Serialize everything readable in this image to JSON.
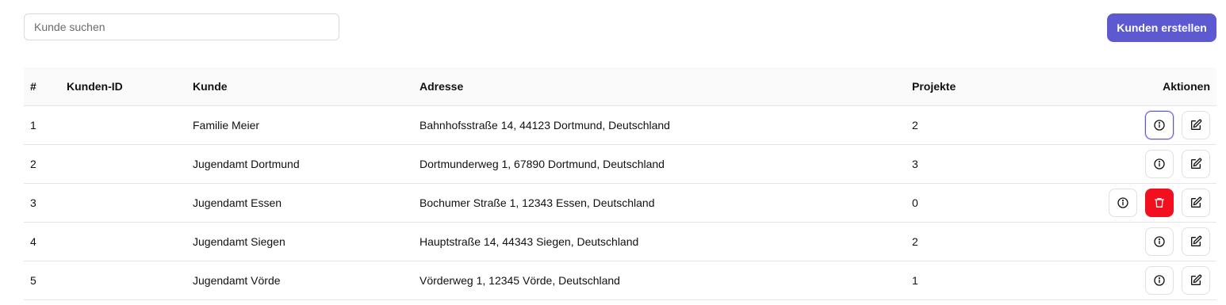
{
  "search": {
    "placeholder": "Kunde suchen",
    "value": ""
  },
  "create_button": {
    "label": "Kunden erstellen",
    "color": "#5d5ad1"
  },
  "table": {
    "headers": {
      "num": "#",
      "id": "Kunden-ID",
      "kunde": "Kunde",
      "adresse": "Adresse",
      "projekte": "Projekte",
      "aktionen": "Aktionen"
    },
    "rows": [
      {
        "num": "1",
        "id": "",
        "kunde": "Familie Meier",
        "adresse": "Bahnhofsstraße 14, 44123 Dortmund, Deutschland",
        "projekte": "2",
        "actions": [
          "info-icon",
          "edit-icon"
        ]
      },
      {
        "num": "2",
        "id": "",
        "kunde": "Jugendamt Dortmund",
        "adresse": "Dortmunderweg 1, 67890 Dortmund, Deutschland",
        "projekte": "3",
        "actions": [
          "info-icon",
          "edit-icon"
        ]
      },
      {
        "num": "3",
        "id": "",
        "kunde": "Jugendamt Essen",
        "adresse": "Bochumer Straße 1, 12343 Essen, Deutschland",
        "projekte": "0",
        "actions": [
          "info-icon",
          "trash-icon",
          "edit-icon"
        ]
      },
      {
        "num": "4",
        "id": "",
        "kunde": "Jugendamt Siegen",
        "adresse": "Hauptstraße 14, 44343 Siegen, Deutschland",
        "projekte": "2",
        "actions": [
          "info-icon",
          "edit-icon"
        ]
      },
      {
        "num": "5",
        "id": "",
        "kunde": "Jugendamt Vörde",
        "adresse": "Vörderweg 1, 12345 Vörde, Deutschland",
        "projekte": "1",
        "actions": [
          "info-icon",
          "edit-icon"
        ]
      }
    ]
  },
  "colors": {
    "accent": "#5d5ad1",
    "danger": "#f20f1e"
  }
}
